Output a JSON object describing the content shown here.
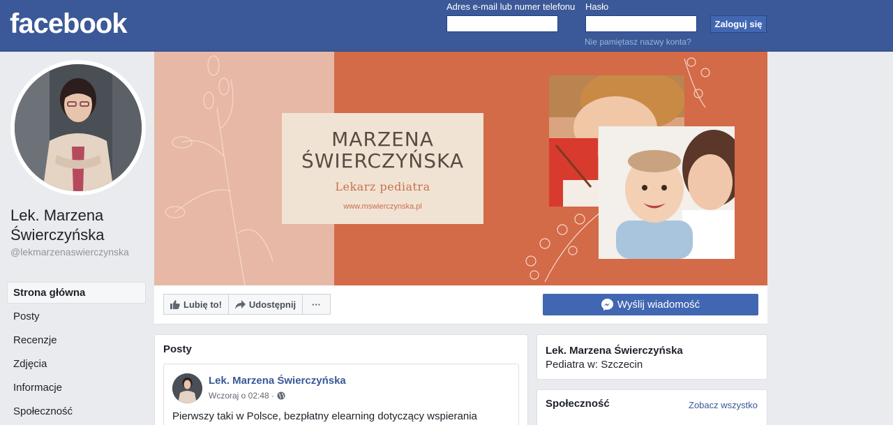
{
  "header": {
    "logo": "facebook",
    "email_label": "Adres e-mail lub numer telefonu",
    "password_label": "Hasło",
    "login_button": "Zaloguj się",
    "forgot_link": "Nie pamiętasz nazwy konta?"
  },
  "profile": {
    "name": "Lek. Marzena Świerczyńska",
    "handle": "@lekmarzenaswierczynska"
  },
  "nav": {
    "items": [
      "Strona główna",
      "Posty",
      "Recenzje",
      "Zdjęcia",
      "Informacje",
      "Społeczność"
    ]
  },
  "cover": {
    "name_line1": "MARZENA",
    "name_line2": "ŚWIERCZYŃSKA",
    "role": "Lekarz pediatra",
    "url": "www.mswierczynska.pl"
  },
  "actions": {
    "like": "Lubię to!",
    "share": "Udostępnij",
    "more": "···",
    "message": "Wyślij wiadomość"
  },
  "posts_section": {
    "title": "Posty",
    "post": {
      "author": "Lek. Marzena Świerczyńska",
      "time": "Wczoraj o 02:48 ·",
      "text": "Pierwszy taki w Polsce, bezpłatny elearning dotyczący wspierania"
    }
  },
  "about_card": {
    "name": "Lek. Marzena Świerczyńska",
    "category": "Pediatra w: Szczecin"
  },
  "community_card": {
    "title": "Społeczność",
    "see_all": "Zobacz wszystko"
  },
  "colors": {
    "brand": "#3b5998",
    "button_blue": "#4267b2",
    "link": "#385898",
    "cover_terracotta": "#d36a48",
    "cover_peach": "#e7b8a6"
  }
}
